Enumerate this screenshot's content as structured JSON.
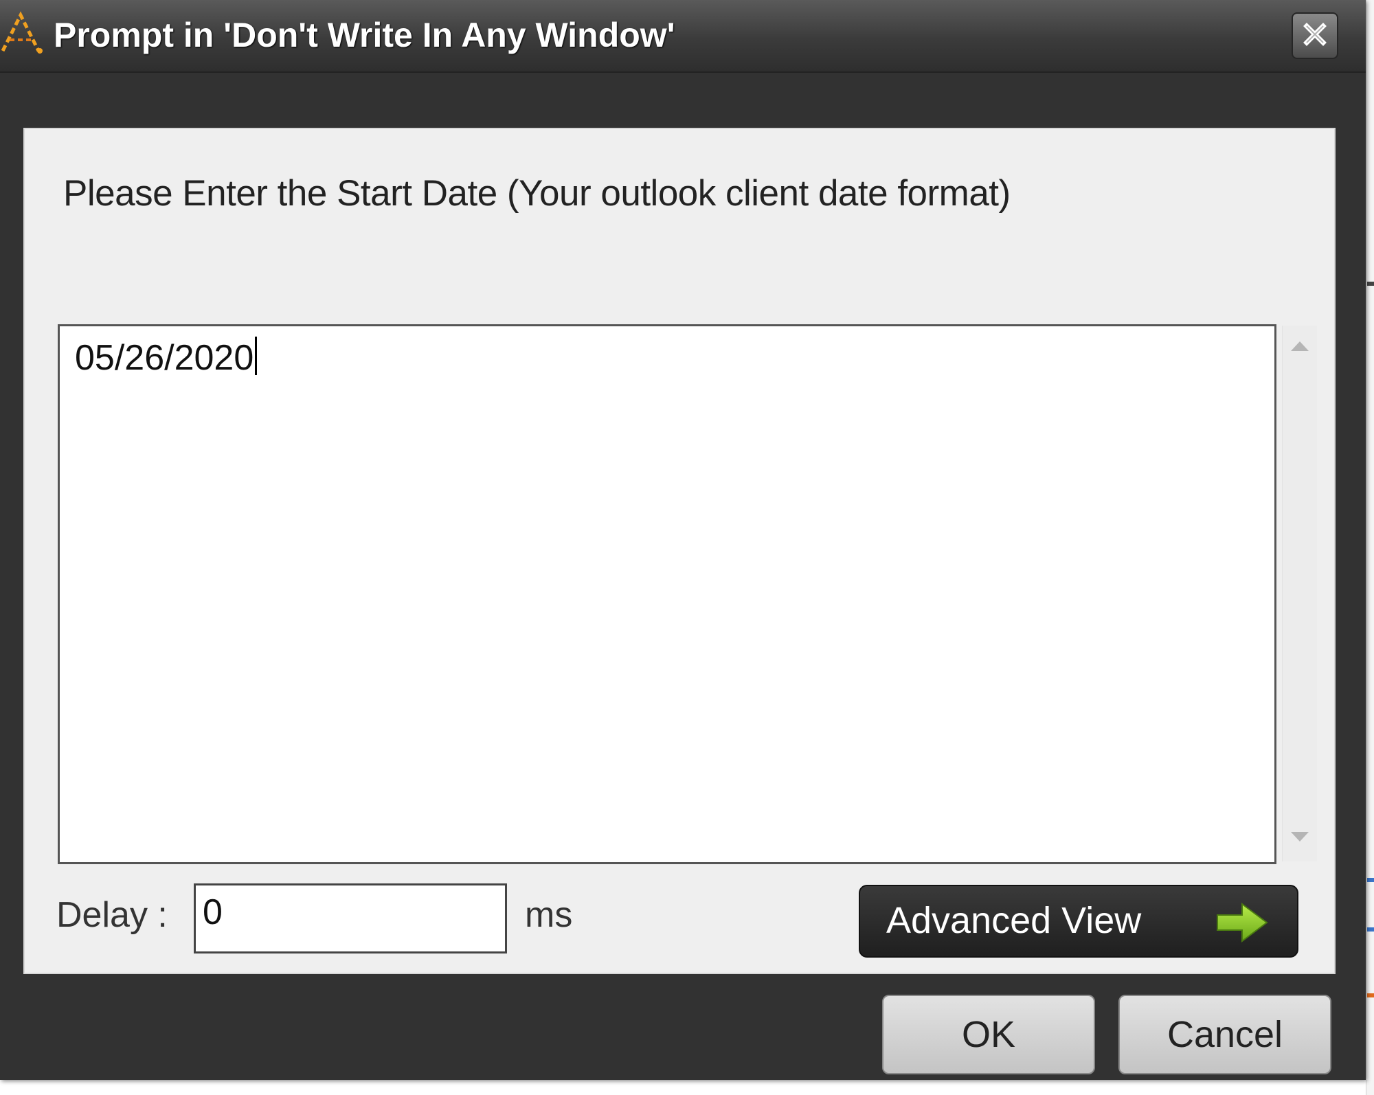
{
  "window": {
    "title": "Prompt in 'Don't Write In Any Window'",
    "title_icon": "app-logo-icon",
    "close_icon": "close-icon"
  },
  "prompt": {
    "label": "Please Enter the Start Date (Your outlook client date format)",
    "value": "05/26/2020"
  },
  "scrollbar": {
    "up_icon": "scroll-up-arrow-icon",
    "down_icon": "scroll-down-arrow-icon"
  },
  "delay": {
    "label": "Delay :",
    "value": "0",
    "unit": "ms"
  },
  "advanced_view": {
    "label": "Advanced View",
    "icon": "right-arrow-icon",
    "icon_color": "#7ec022"
  },
  "buttons": {
    "ok": "OK",
    "cancel": "Cancel"
  },
  "colors": {
    "window_bg": "#323232",
    "panel_bg": "#efefef",
    "button_dark": "#1f1f1f",
    "button_light": "#d4d4d4"
  }
}
